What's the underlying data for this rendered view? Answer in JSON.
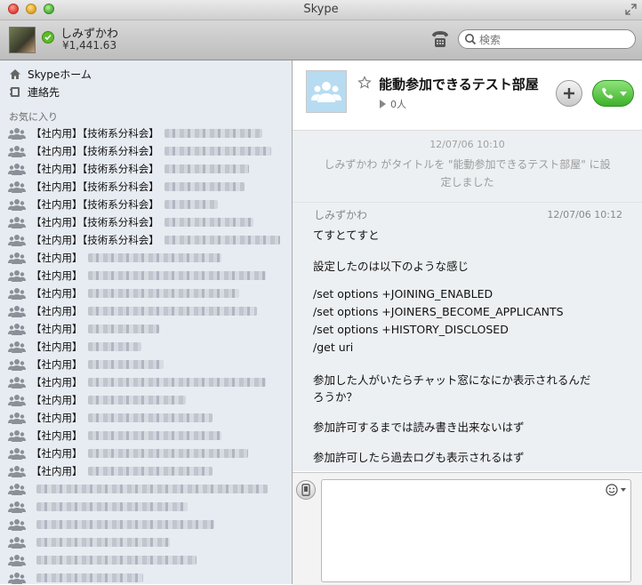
{
  "window": {
    "title": "Skype"
  },
  "profile": {
    "name": "しみずかわ",
    "credit": "¥1,441.63"
  },
  "search": {
    "placeholder": "検索"
  },
  "sidebar": {
    "nav": [
      {
        "label": "Skypeホーム"
      },
      {
        "label": "連絡先"
      }
    ],
    "favorites_title": "お気に入り",
    "favorites": [
      {
        "label": "【社内用】【技術系分科会】"
      },
      {
        "label": "【社内用】【技術系分科会】"
      },
      {
        "label": "【社内用】【技術系分科会】"
      },
      {
        "label": "【社内用】【技術系分科会】"
      },
      {
        "label": "【社内用】【技術系分科会】"
      },
      {
        "label": "【社内用】【技術系分科会】"
      },
      {
        "label": "【社内用】【技術系分科会】"
      },
      {
        "label": "【社内用】"
      },
      {
        "label": "【社内用】"
      },
      {
        "label": "【社内用】"
      },
      {
        "label": "【社内用】"
      },
      {
        "label": "【社内用】"
      },
      {
        "label": "【社内用】"
      },
      {
        "label": "【社内用】"
      },
      {
        "label": "【社内用】"
      },
      {
        "label": "【社内用】"
      },
      {
        "label": "【社内用】"
      },
      {
        "label": "【社内用】"
      },
      {
        "label": "【社内用】"
      },
      {
        "label": "【社内用】"
      },
      {
        "label": ""
      },
      {
        "label": ""
      },
      {
        "label": ""
      },
      {
        "label": ""
      },
      {
        "label": ""
      },
      {
        "label": ""
      }
    ]
  },
  "conversation": {
    "title": "能動参加できるテスト部屋",
    "participants": "0人",
    "system_message": {
      "time": "12/07/06 10:10",
      "text": "しみずかわ がタイトルを \"能動参加できるテスト部屋\" に設定しました"
    },
    "message": {
      "sender": "しみずかわ",
      "time": "12/07/06 10:12",
      "lines": [
        "てすとてすと",
        "設定したのは以下のような感じ",
        "/set options +JOINING_ENABLED",
        "/set options +JOINERS_BECOME_APPLICANTS",
        "/set options +HISTORY_DISCLOSED",
        "/get uri",
        "参加した人がいたらチャット窓になにか表示されるんだ",
        "ろうか？",
        "参加許可するまでは読み書き出来ないはず",
        "参加許可したら過去ログも表示されるはず"
      ]
    },
    "input": {
      "value": ""
    }
  },
  "colors": {
    "call_green": "#3db12a",
    "status_online": "#5dbb2a",
    "room_avatar": "#b7dcf2"
  }
}
